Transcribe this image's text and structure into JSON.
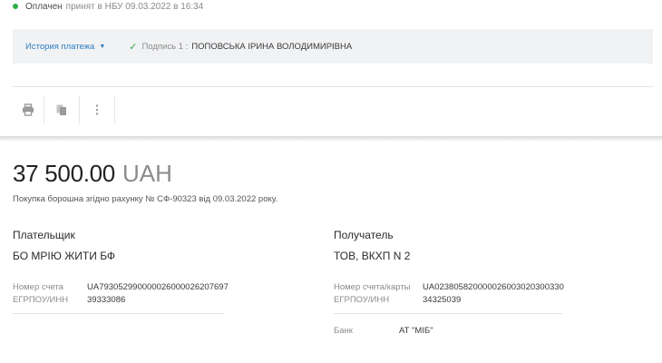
{
  "status": {
    "state": "Оплачен",
    "detail": "принят в НБУ 09.03.2022 в 16:34",
    "color": "#2fae48"
  },
  "panel": {
    "history_label": "История платежа",
    "signature_label": "Подпись 1 :",
    "signer": "ПОПОВСЬКА ІРИНА ВОЛОДИМИРІВНА"
  },
  "toolbar": {
    "icons": [
      "print-icon",
      "copy-icon",
      "more-vertical-icon"
    ]
  },
  "payment": {
    "amount": "37 500.00",
    "currency": "UAH",
    "purpose": "Покупка борошна згідно рахунку № СФ-90323 від 09.03.2022 року."
  },
  "payer": {
    "heading": "Плательщик",
    "name": "БО МРІЮ ЖИТИ БФ",
    "account_label": "Номер счета",
    "account": "UA793052990000026000026207697",
    "edrpou_label": "ЕГРПОУ/ИНН",
    "edrpou": "39333086"
  },
  "recipient": {
    "heading": "Получатель",
    "name": "ТОВ, ВКХП N 2",
    "account_label": "Номер счета/карты",
    "account": "UA023805820000026003020300330",
    "edrpou_label": "ЕГРПОУ/ИНН",
    "edrpou": "34325039",
    "bank_label": "Банк",
    "bank": "АТ \"МІБ\""
  }
}
